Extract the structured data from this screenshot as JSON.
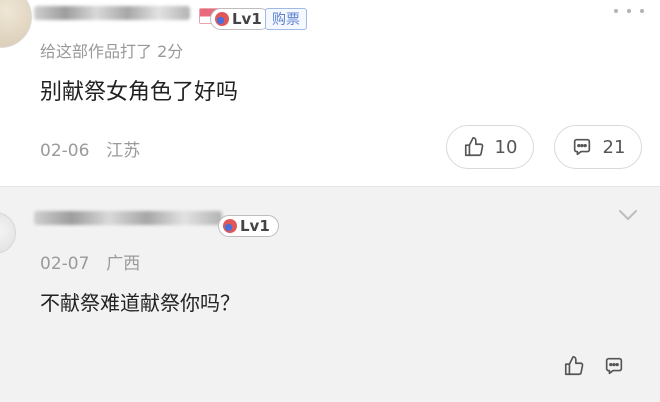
{
  "comment_top": {
    "level_label": "Lv1",
    "buy_badge": "购票",
    "rating_text": "给这部作品打了 2分",
    "content": "别献祭女角色了好吗",
    "date": "02-06",
    "location": "江苏",
    "likes": "10",
    "replies": "21"
  },
  "comment_bottom": {
    "level_label": "Lv1",
    "date": "02-07",
    "location": "广西",
    "content": "不献祭难道献祭你吗？"
  },
  "icons": {
    "like": "thumbs-up-icon",
    "reply": "chat-bubble-icon",
    "more": "more-horizontal-icon",
    "expand": "chevron-down-icon"
  },
  "colors": {
    "buy_badge": "#5b82d1",
    "secondary_text": "#9a9a9a",
    "reply_bg": "#f2f2f2"
  }
}
